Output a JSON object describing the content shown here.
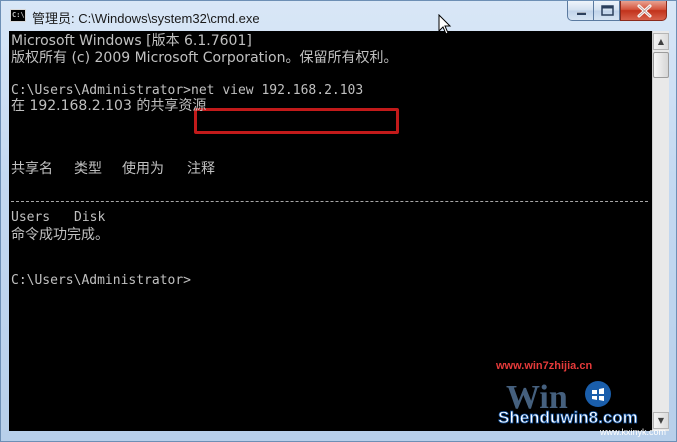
{
  "window": {
    "title": "管理员: C:\\Windows\\system32\\cmd.exe",
    "app_icon_text": "C:\\",
    "buttons": {
      "minimize": "minimize",
      "maximize": "maximize",
      "close": "close"
    }
  },
  "console": {
    "lines": {
      "version": "Microsoft Windows [版本 6.1.7601]",
      "copyright": "版权所有 (c) 2009 Microsoft Corporation。保留所有权利。",
      "prompt1": "C:\\Users\\Administrator>",
      "command": "net view 192.168.2.103",
      "shared_resources": "在 192.168.2.103 的共享资源",
      "header_share_name": "共享名",
      "header_type": "类型",
      "header_used_as": "使用为",
      "header_comment": "注释",
      "row_name": "Users",
      "row_type": "Disk",
      "success": "命令成功完成。",
      "prompt2": "C:\\Users\\Administrator>"
    }
  },
  "watermark": {
    "site_top": "www.win7zhijia.cn",
    "logo_text": "Shenduwin8.com",
    "site_bottom": "www.kxinyk.com"
  },
  "colors": {
    "console_bg": "#000000",
    "console_text": "#c0c0c0",
    "highlight": "#c21a1a"
  }
}
